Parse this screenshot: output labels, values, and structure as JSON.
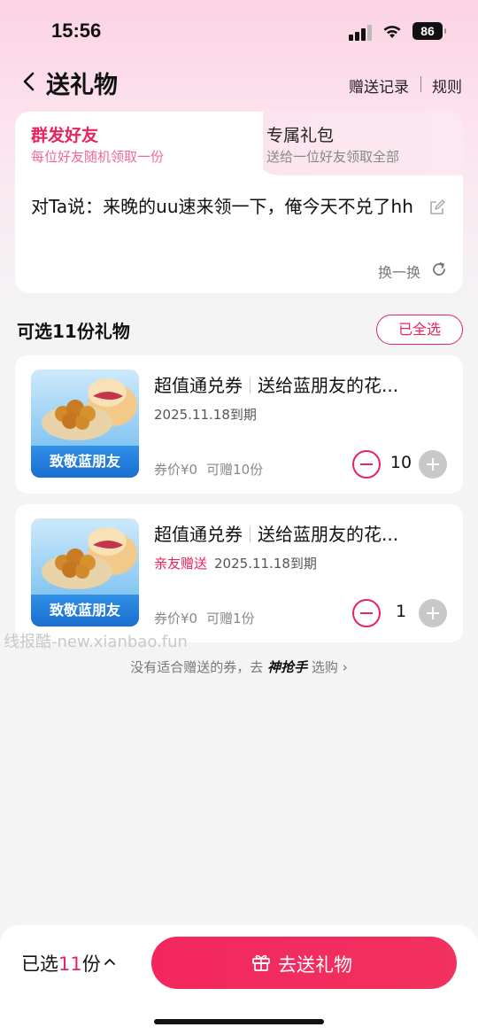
{
  "status_bar": {
    "time": "15:56",
    "battery": "86"
  },
  "nav": {
    "title": "送礼物",
    "record_label": "赠送记录",
    "rules_label": "规则"
  },
  "mode_tabs": [
    {
      "title": "群发好友",
      "subtitle": "每位好友随机领取一份",
      "active": true
    },
    {
      "title": "专属礼包",
      "subtitle": "送给一位好友领取全部",
      "active": false
    }
  ],
  "message": {
    "text": "对Ta说：来晚的uu速来领一下，俺今天不兑了hh",
    "refresh_label": "换一换"
  },
  "gift_list": {
    "title": "可选11份礼物",
    "select_all_label": "已全选",
    "items": [
      {
        "thumb_label": "致敬蓝朋友",
        "type": "超值通兑券",
        "name": "送给蓝朋友的花...",
        "tag": "",
        "expire": "2025.11.18到期",
        "price": "券价¥0",
        "available": "可赠10份",
        "quantity": "10"
      },
      {
        "thumb_label": "致敬蓝朋友",
        "type": "超值通兑券",
        "name": "送给蓝朋友的花...",
        "tag": "亲友赠送",
        "expire": "2025.11.18到期",
        "price": "券价¥0",
        "available": "可赠1份",
        "quantity": "1"
      }
    ]
  },
  "watermark": "线报酷-new.xianbao.fun",
  "hint": {
    "prefix": "没有适合赠送的券，去",
    "brand": "神抢手",
    "link": "选购"
  },
  "bottom": {
    "selected_prefix": "已选",
    "selected_count": "11",
    "selected_suffix": "份",
    "send_label": "去送礼物"
  },
  "colors": {
    "accent": "#e8245c",
    "thumb_banner": "#1b6fd0",
    "disabled": "#c8c8c8"
  }
}
